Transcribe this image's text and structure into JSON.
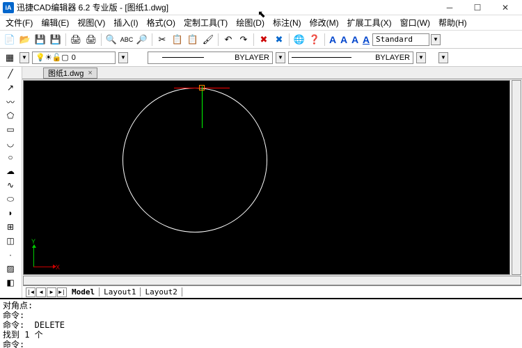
{
  "title": "迅捷CAD编辑器 6.2 专业版  - [图纸1.dwg]",
  "menus": [
    "文件(F)",
    "编辑(E)",
    "视图(V)",
    "插入(I)",
    "格式(O)",
    "定制工具(T)",
    "绘图(D)",
    "标注(N)",
    "修改(M)",
    "扩展工具(X)",
    "窗口(W)",
    "帮助(H)"
  ],
  "style_box": "Standard",
  "layer_value": "0",
  "line_style": "BYLAYER",
  "line_weight": "BYLAYER",
  "tab_name": "图纸1.dwg",
  "layout_tabs": {
    "model": "Model",
    "l1": "Layout1",
    "l2": "Layout2"
  },
  "ucs": {
    "x": "X",
    "y": "Y"
  },
  "cmd": {
    "l1": "对角点:",
    "l2": "命令:",
    "l3": "命令:  DELETE",
    "l4": "找到 1 个",
    "l5": "命令:"
  }
}
